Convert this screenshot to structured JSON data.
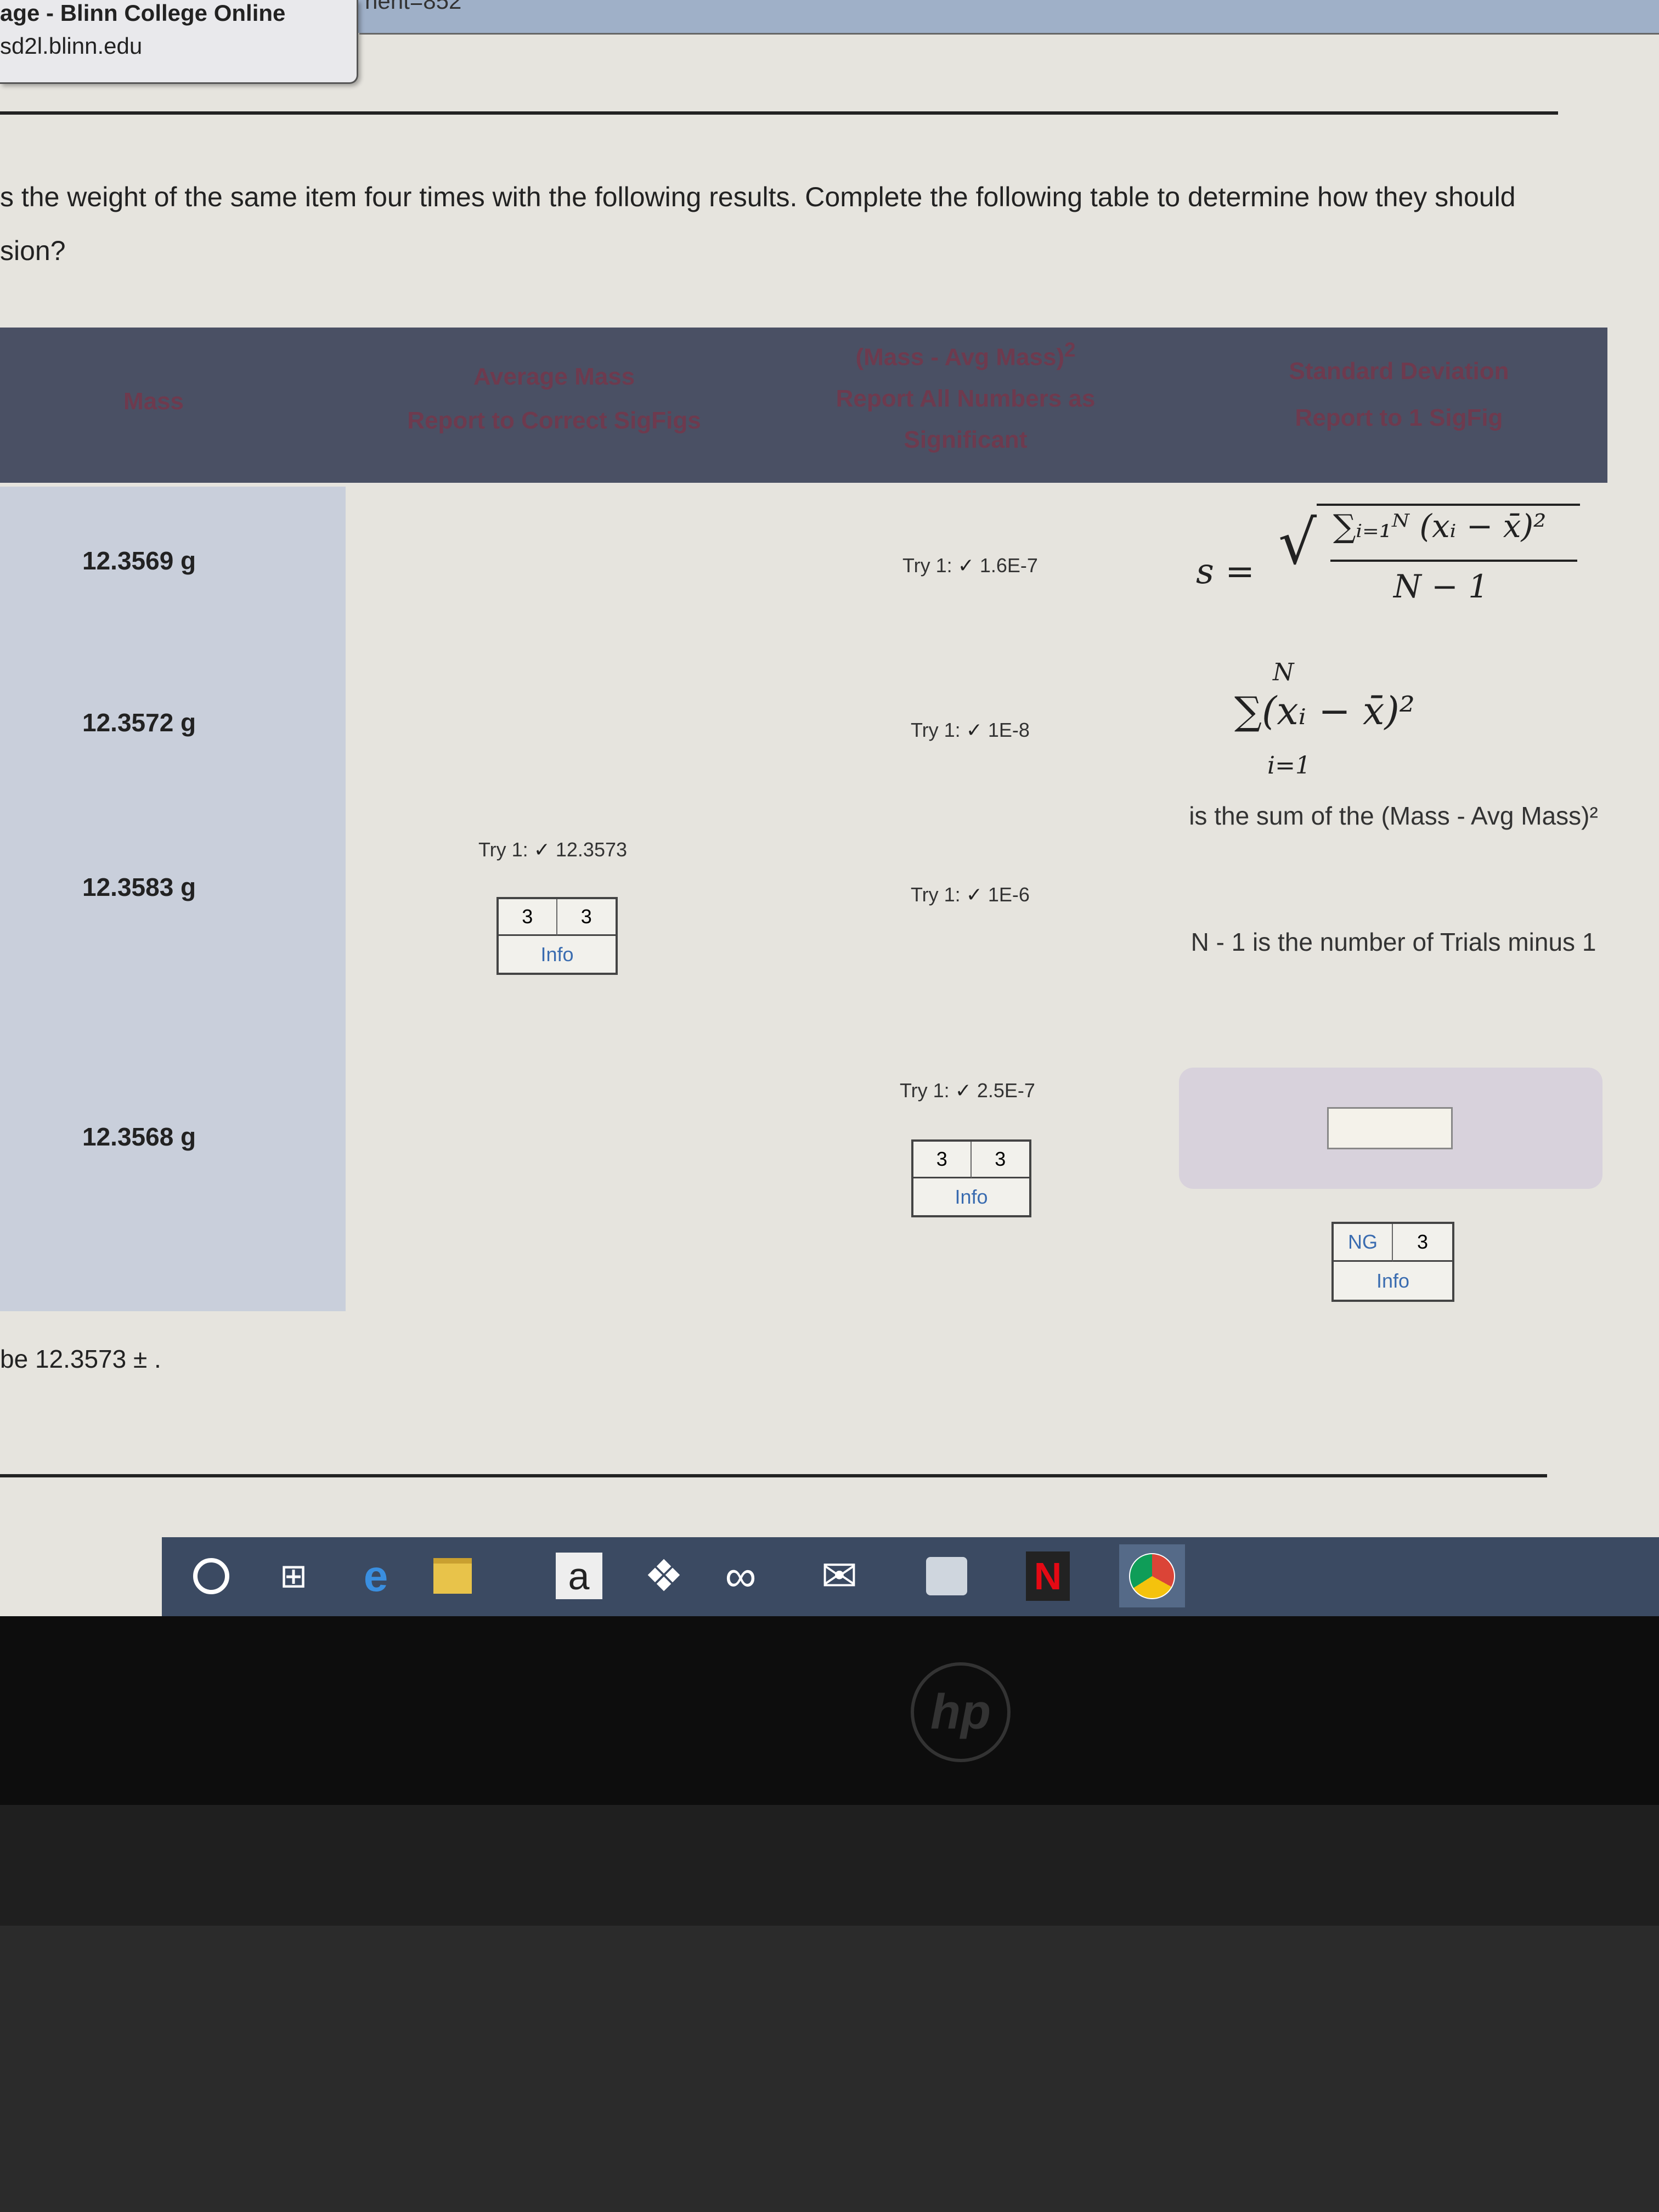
{
  "browser": {
    "tab_title": "age - Blinn College Online",
    "tab_url": "sd2l.blinn.edu",
    "url_fragment": "nent=852"
  },
  "question": {
    "line1": "s the weight of the same item four times with the following results.  Complete the following table to determine how they should",
    "line2": "sion?"
  },
  "table": {
    "headers": {
      "mass": "Mass",
      "avg_title": "Average Mass",
      "avg_sub": "Report to Correct SigFigs",
      "sq_title": "(Mass - Avg Mass)",
      "sq_sup": "2",
      "sq_sub1": "Report All Numbers as",
      "sq_sub2": "Significant",
      "sd_title": "Standard Deviation",
      "sd_sub": "Report to 1 SigFig"
    },
    "masses": [
      "12.3569 g",
      "12.3572 g",
      "12.3583 g",
      "12.3568 g"
    ],
    "average": {
      "try": "Try 1:",
      "check": "✓",
      "value": "12.3573",
      "sig_left": "3",
      "sig_right": "3",
      "info": "Info"
    },
    "squares": [
      {
        "try": "Try 1:",
        "check": "✓",
        "value": "1.6E-7"
      },
      {
        "try": "Try 1:",
        "check": "✓",
        "value": "1E-8"
      },
      {
        "try": "Try 1:",
        "check": "✓",
        "value": "1E-6"
      },
      {
        "try": "Try 1:",
        "check": "✓",
        "value": "2.5E-7"
      }
    ],
    "squares_sigbox": {
      "left": "3",
      "right": "3",
      "info": "Info"
    },
    "sd": {
      "formula_lhs": "s =",
      "formula_num": "∑ᵢ₌₁ᴺ (xᵢ − x̄)²",
      "formula_den": "N − 1",
      "sum_top": "N",
      "sum_body": "∑(xᵢ − x̄)²",
      "sum_bottom": "i=1",
      "note1": "is the sum of the (Mass - Avg Mass)²",
      "note2": "N - 1 is the number of Trials minus 1",
      "input_value": "",
      "sig_left": "NG",
      "sig_right": "3",
      "info": "Info"
    }
  },
  "answer_line": "be 12.3573 ± .",
  "taskbar": {
    "icons": [
      "cortana-icon",
      "task-view-icon",
      "edge-icon",
      "file-explorer-icon",
      "amazon-icon",
      "dropbox-icon",
      "infinity-icon",
      "mail-icon",
      "photos-icon",
      "netflix-icon",
      "chrome-icon"
    ],
    "amazon_label": "a",
    "netflix_label": "N"
  },
  "laptop": {
    "logo": "hp"
  }
}
